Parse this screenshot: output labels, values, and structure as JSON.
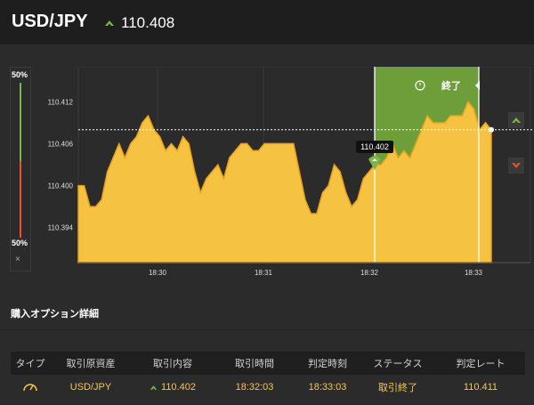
{
  "header": {
    "pair": "USD/JPY",
    "rate": "110.408",
    "direction_icon": "arrow-up-icon",
    "up_color": "#7ab648"
  },
  "chart": {
    "y_ticks": [
      "110.412",
      "110.406",
      "110.400",
      "110.394"
    ],
    "x_ticks": [
      "18:30",
      "18:31",
      "18:32",
      "18:33"
    ],
    "entry_label": "110.402",
    "end_label": "終了",
    "fill_color": "#f5c242",
    "win_zone_color": "#6e9e3a"
  },
  "gauge": {
    "top_label": "50%",
    "bottom_label": "50%",
    "up_percent": 50,
    "down_percent": 50,
    "close": "×"
  },
  "chart_data": {
    "type": "area",
    "title": "",
    "xlabel": "",
    "ylabel": "",
    "ylim": [
      110.389,
      110.417
    ],
    "x_ticks": [
      "18:30",
      "18:31",
      "18:32",
      "18:33"
    ],
    "entry_price": 110.402,
    "current_price": 110.408,
    "series": [
      {
        "values": [
          110.4,
          110.4,
          110.397,
          110.397,
          110.398,
          110.402,
          110.404,
          110.406,
          110.404,
          110.406,
          110.407,
          110.409,
          110.41,
          110.408,
          110.407,
          110.405,
          110.406,
          110.405,
          110.407,
          110.406,
          110.402,
          110.399,
          110.401,
          110.402,
          110.403,
          110.401,
          110.404,
          110.405,
          110.406,
          110.406,
          110.405,
          110.405,
          110.406,
          110.406,
          110.406,
          110.406,
          110.406,
          110.406,
          110.402,
          110.398,
          110.396,
          110.396,
          110.399,
          110.4,
          110.403,
          110.402,
          110.399,
          110.397,
          110.398,
          110.401,
          110.402,
          110.403,
          110.403,
          110.404,
          110.406,
          110.404,
          110.405,
          110.404,
          110.406,
          110.408,
          110.41,
          110.409,
          110.409,
          110.409,
          110.41,
          110.41,
          110.41,
          110.412,
          110.411,
          110.408,
          110.409,
          110.408
        ]
      }
    ]
  },
  "details": {
    "title": "購入オプション詳細",
    "columns": [
      "タイプ",
      "取引原資産",
      "取引内容",
      "取引時間",
      "判定時刻",
      "ステータス",
      "判定レート"
    ],
    "rows": [
      {
        "type_icon": "gauge-icon",
        "asset": "USD/JPY",
        "direction_icon": "arrow-up-icon",
        "rate": "110.402",
        "trade_time": "18:32:03",
        "judge_time": "18:33:03",
        "status": "取引終了",
        "judge_rate": "110.411"
      }
    ]
  }
}
